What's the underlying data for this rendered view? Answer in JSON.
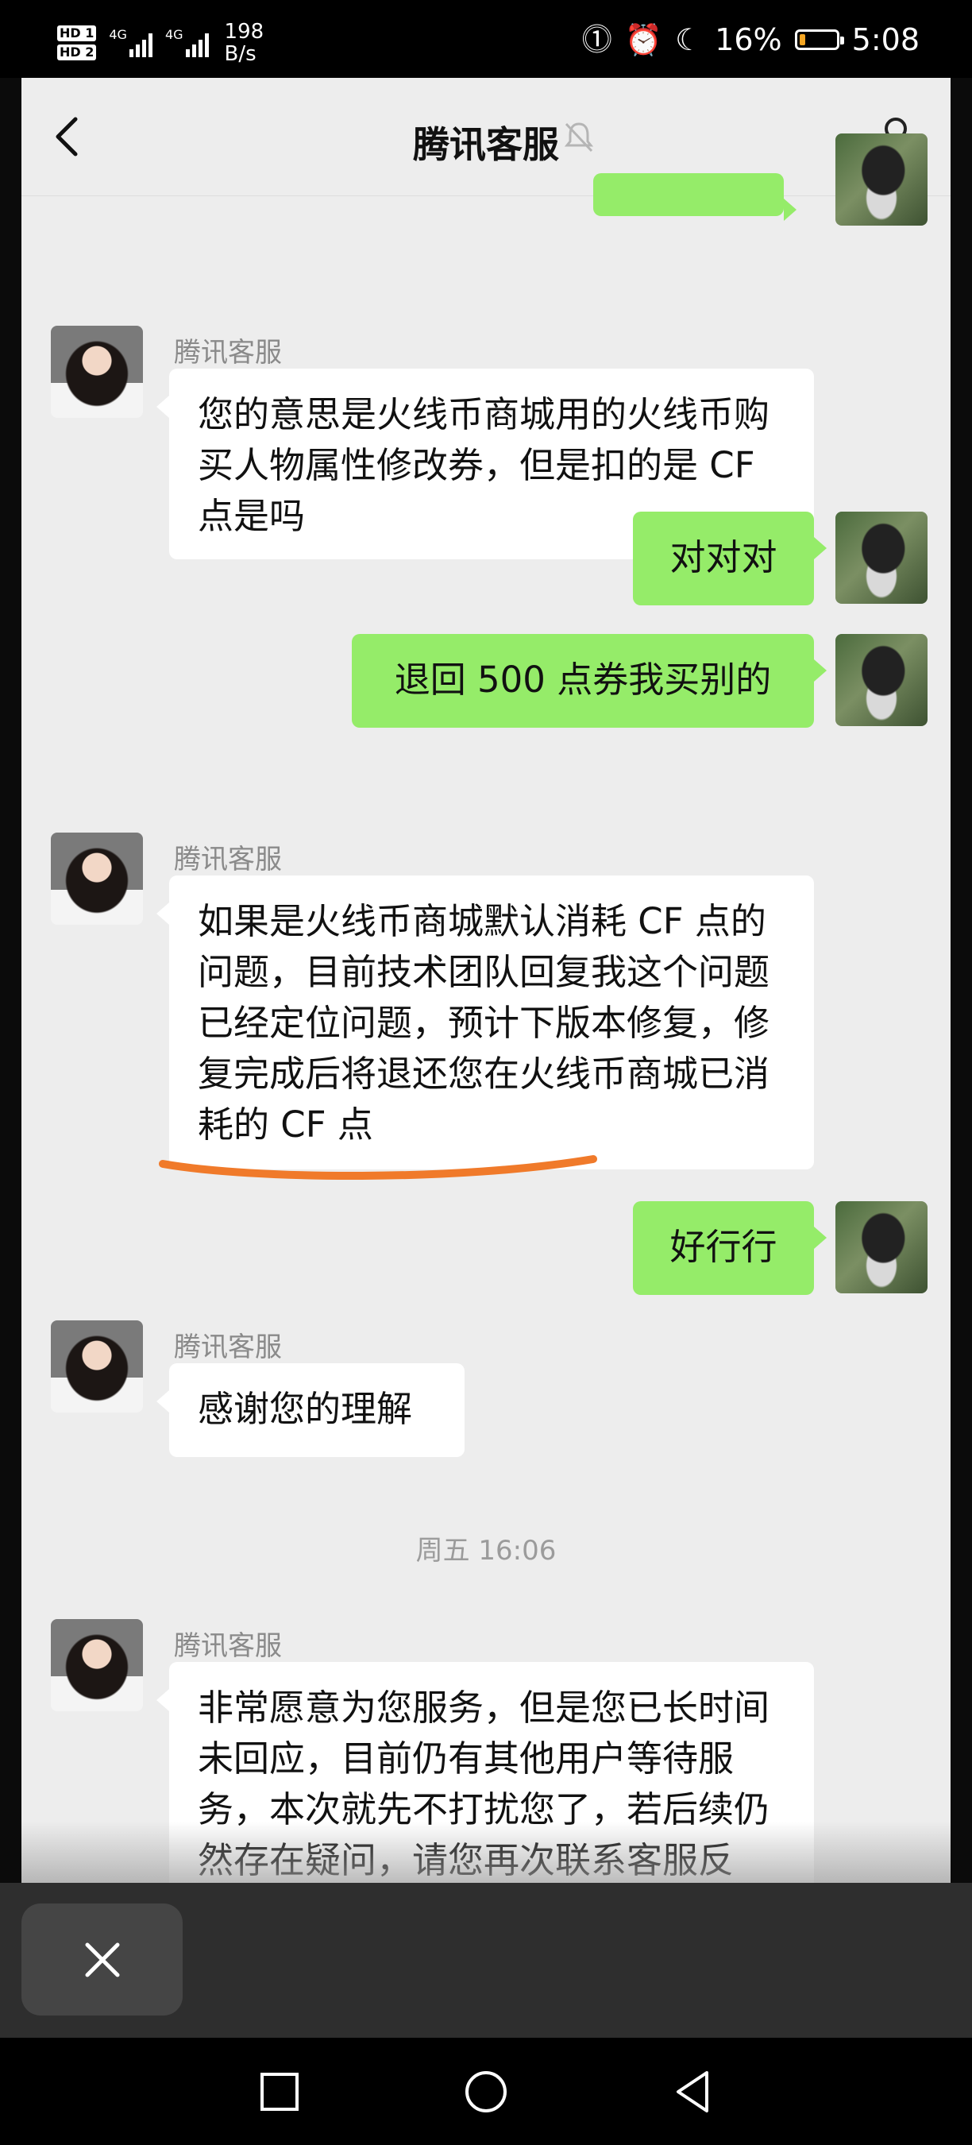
{
  "status_bar": {
    "hd1": "HD 1",
    "hd2": "HD 2",
    "network1": "4G",
    "network2": "4G",
    "speed_value": "198",
    "speed_unit": "B/s",
    "battery_text": "16%",
    "battery_level": 0.16,
    "time": "5:08"
  },
  "topbar": {
    "title": "腾讯客服"
  },
  "messages": [
    {
      "from": "cs",
      "name": "腾讯客服",
      "text": "您的意思是火线币商城用的火线币购买人物属性修改券，但是扣的是 CF 点是吗"
    },
    {
      "from": "user",
      "text": "对对对"
    },
    {
      "from": "user",
      "text": "退回 500 点券我买别的"
    },
    {
      "from": "cs",
      "name": "腾讯客服",
      "text": "如果是火线币商城默认消耗 CF 点的问题，目前技术团队回复我这个问题已经定位问题，预计下版本修复，修复完成后将退还您在火线币商城已消耗的 CF 点"
    },
    {
      "from": "user",
      "text": "好行行"
    },
    {
      "from": "cs",
      "name": "腾讯客服",
      "text": "感谢您的理解"
    },
    {
      "from": "cs",
      "name": "腾讯客服",
      "text": "非常愿意为您服务，但是您已长时间未回应，目前仍有其他用户等待服务，本次就先不打扰您了，若后续仍然存在疑问，请您再次联系客服反馈，感谢您的理解，祝您生活愉快，再见"
    }
  ],
  "timestamp": "周五 16:06",
  "colors": {
    "out_bubble": "#95ec69",
    "in_bubble": "#ffffff",
    "underline": "#f07a2a"
  }
}
